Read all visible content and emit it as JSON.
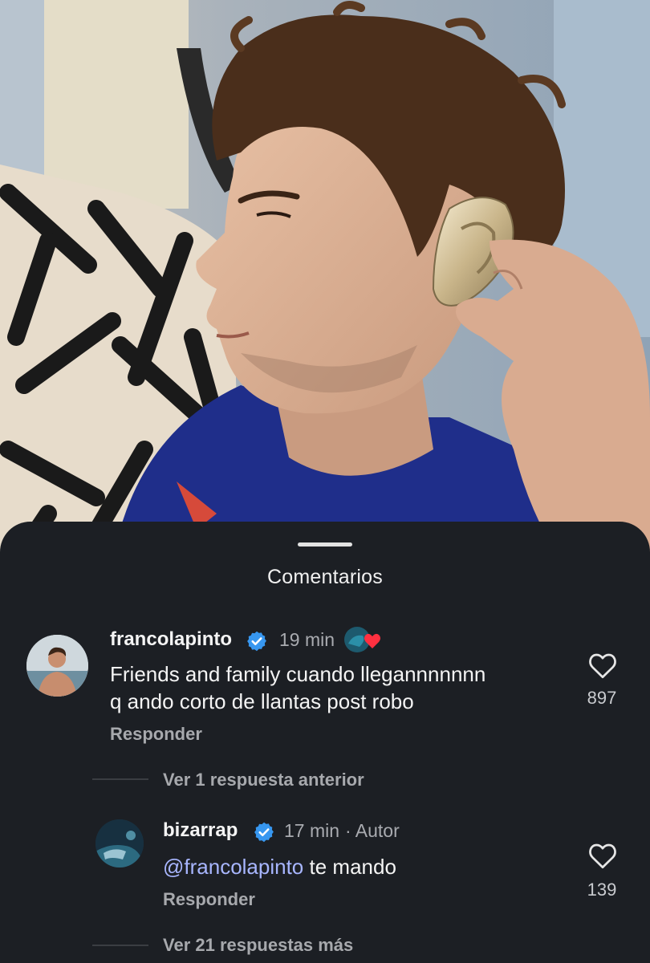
{
  "sheet": {
    "title": "Comentarios"
  },
  "comments": [
    {
      "username": "francolapinto",
      "time": "19 min",
      "text_line1": "Friends and family cuando llegannnnnnn",
      "text_line2": "q ando corto de llantas post robo",
      "reply_label": "Responder",
      "likes": "897"
    }
  ],
  "thread": {
    "view_previous": "Ver 1 respuesta anterior",
    "reply": {
      "username": "bizarrap",
      "time": "17 min",
      "author_badge": "· Autor",
      "mention": "@francolapinto",
      "text": " te mando",
      "reply_label": "Responder",
      "likes": "139"
    },
    "view_more": "Ver 21 respuestas más"
  },
  "icons": {
    "verified": "verified-badge-icon",
    "like": "heart-outline-icon",
    "reaction": "heart-reaction-icon"
  },
  "colors": {
    "sheet_bg": "#1c1f24",
    "verified": "#3797f0",
    "mention": "#a8b6ff",
    "heart": "#ff3040"
  }
}
